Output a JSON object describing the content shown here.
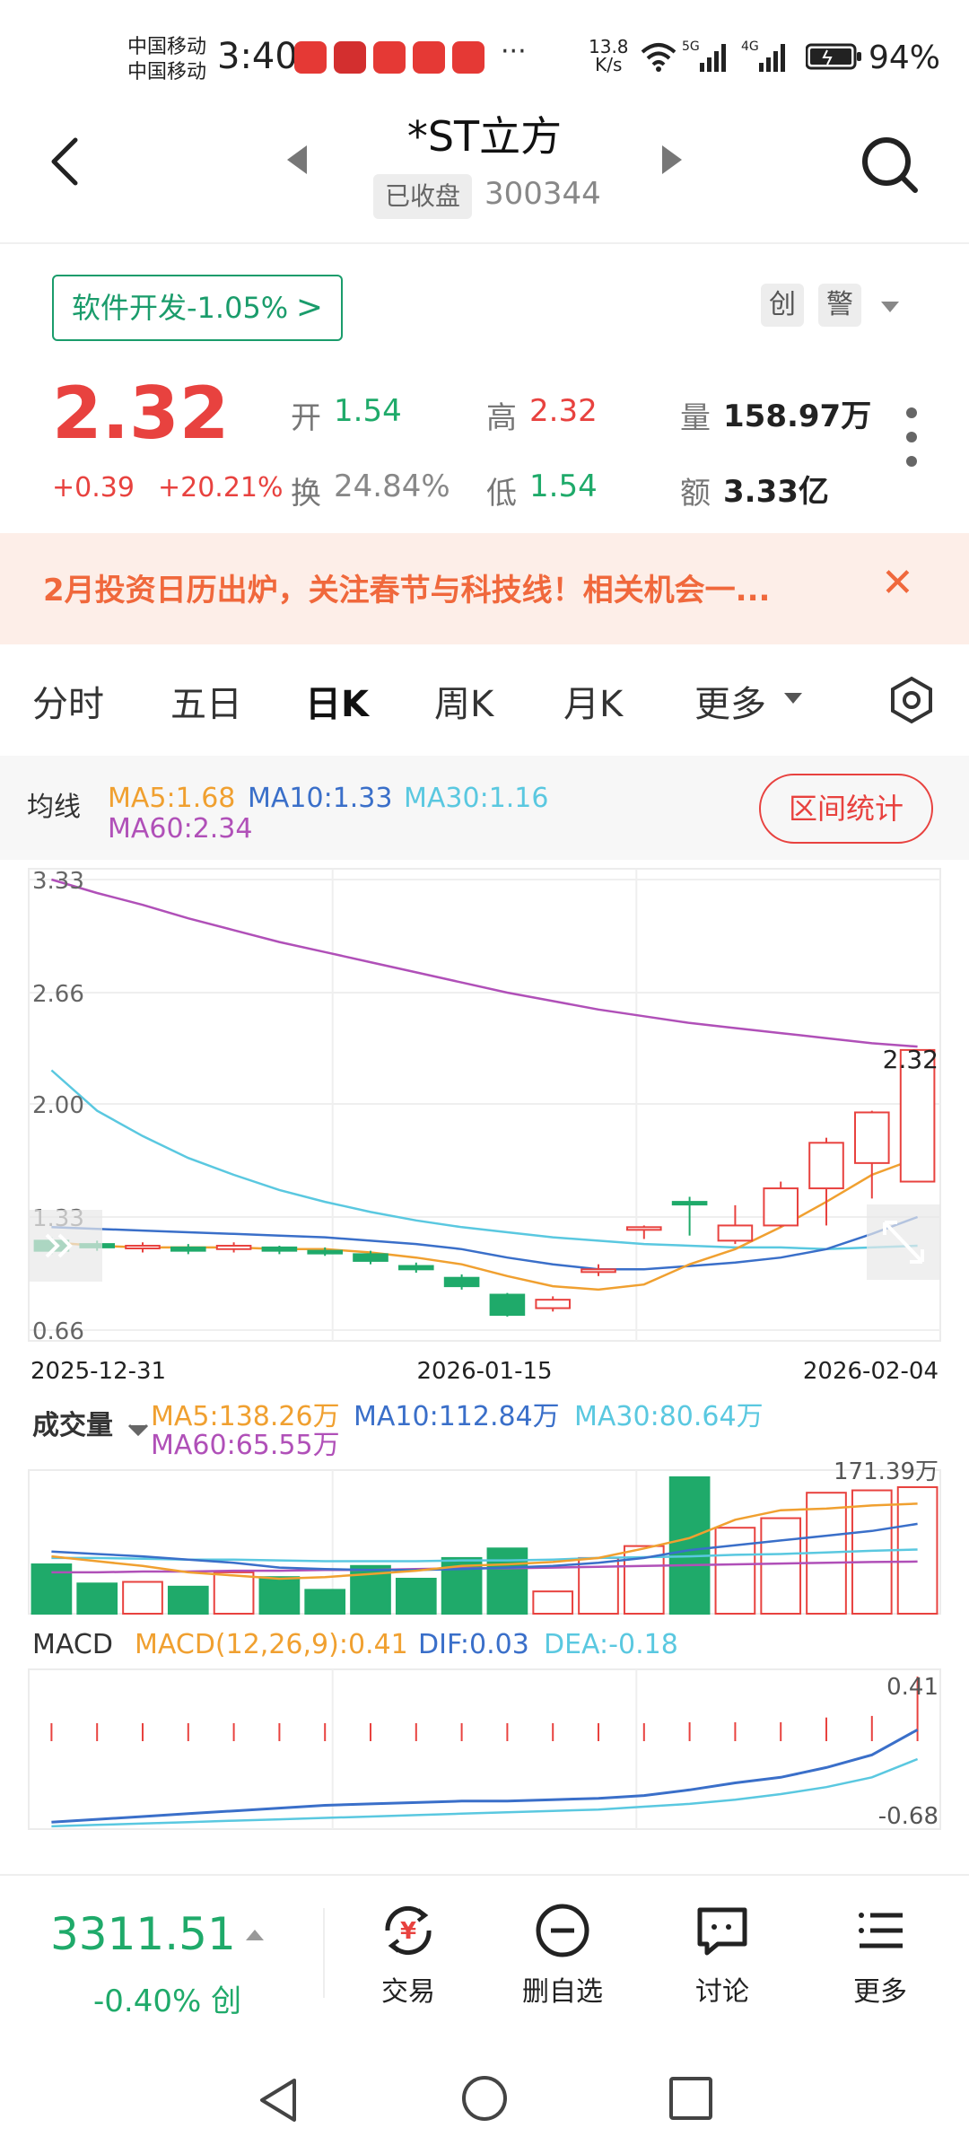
{
  "status_bar": {
    "carrier1": "中国移动",
    "carrier2": "中国移动",
    "time": "3:40",
    "more": "···",
    "net_speed_value": "13.8",
    "net_speed_unit": "K/s",
    "signal1": "5G",
    "signal2": "4G",
    "battery": "94%"
  },
  "header": {
    "title": "*ST立方",
    "status_tag": "已收盘",
    "code": "300344"
  },
  "sector": {
    "label": "软件开发-1.05%",
    "tag1": "创",
    "tag2": "警"
  },
  "quote": {
    "price": "2.32",
    "change": "+0.39",
    "change_pct": "+20.21%",
    "open_label": "开",
    "open": "1.54",
    "high_label": "高",
    "high": "2.32",
    "volume_label": "量",
    "volume": "158.97万",
    "turnover_label": "换",
    "turnover": "24.84%",
    "low_label": "低",
    "low": "1.54",
    "amount_label": "额",
    "amount": "3.33亿"
  },
  "banner": {
    "text": "2月投资日历出炉，关注春节与科技线！相关机会一...",
    "close": "✕"
  },
  "tabs": [
    "分时",
    "五日",
    "日K",
    "周K",
    "月K",
    "更多"
  ],
  "active_tab": "日K",
  "ma_legend": {
    "title": "均线",
    "ma5": "MA5:1.68",
    "ma10": "MA10:1.33",
    "ma30": "MA30:1.16",
    "ma60": "MA60:2.34",
    "range_button": "区间统计"
  },
  "colors": {
    "up": "#e8423f",
    "down": "#1faa6a",
    "ma5": "#f0a030",
    "ma10": "#3a6fc9",
    "ma30": "#5ac8e0",
    "ma60": "#b050b8"
  },
  "chart_data": [
    {
      "type": "candlestick",
      "y_ticks": [
        "3.33",
        "2.66",
        "2.00",
        "1.33",
        "0.66"
      ],
      "ylim": [
        0.66,
        3.33
      ],
      "x_labels": [
        "2025-12-31",
        "2026-01-15",
        "2026-02-04"
      ],
      "last_price_label": "2.32",
      "candles": [
        {
          "o": 1.19,
          "c": 1.13,
          "h": 1.21,
          "l": 1.11
        },
        {
          "o": 1.17,
          "c": 1.15,
          "h": 1.19,
          "l": 1.13
        },
        {
          "o": 1.15,
          "c": 1.16,
          "h": 1.18,
          "l": 1.12
        },
        {
          "o": 1.15,
          "c": 1.13,
          "h": 1.17,
          "l": 1.11
        },
        {
          "o": 1.14,
          "c": 1.16,
          "h": 1.18,
          "l": 1.12
        },
        {
          "o": 1.15,
          "c": 1.13,
          "h": 1.16,
          "l": 1.11
        },
        {
          "o": 1.13,
          "c": 1.12,
          "h": 1.15,
          "l": 1.1
        },
        {
          "o": 1.11,
          "c": 1.07,
          "h": 1.13,
          "l": 1.05
        },
        {
          "o": 1.04,
          "c": 1.02,
          "h": 1.06,
          "l": 1.0
        },
        {
          "o": 0.97,
          "c": 0.92,
          "h": 0.99,
          "l": 0.9
        },
        {
          "o": 0.87,
          "c": 0.75,
          "h": 0.88,
          "l": 0.74
        },
        {
          "o": 0.79,
          "c": 0.84,
          "h": 0.86,
          "l": 0.77
        },
        {
          "o": 1.01,
          "c": 1.02,
          "h": 1.05,
          "l": 0.98
        },
        {
          "o": 1.26,
          "c": 1.27,
          "h": 1.28,
          "l": 1.2
        },
        {
          "o": 1.42,
          "c": 1.41,
          "h": 1.45,
          "l": 1.22
        },
        {
          "o": 1.19,
          "c": 1.28,
          "h": 1.4,
          "l": 1.17
        },
        {
          "o": 1.28,
          "c": 1.5,
          "h": 1.54,
          "l": 1.27
        },
        {
          "o": 1.5,
          "c": 1.77,
          "h": 1.8,
          "l": 1.28
        },
        {
          "o": 1.65,
          "c": 1.95,
          "h": 1.96,
          "l": 1.44
        },
        {
          "o": 1.54,
          "c": 2.32,
          "h": 2.32,
          "l": 1.54
        }
      ],
      "ma5": [
        1.18,
        1.16,
        1.15,
        1.15,
        1.15,
        1.14,
        1.14,
        1.12,
        1.09,
        1.05,
        0.98,
        0.92,
        0.9,
        0.93,
        1.05,
        1.14,
        1.27,
        1.42,
        1.58,
        1.68
      ],
      "ma10": [
        1.27,
        1.26,
        1.25,
        1.24,
        1.23,
        1.22,
        1.21,
        1.19,
        1.17,
        1.14,
        1.09,
        1.05,
        1.02,
        1.02,
        1.04,
        1.06,
        1.09,
        1.14,
        1.23,
        1.33
      ],
      "ma30": [
        2.2,
        1.96,
        1.81,
        1.68,
        1.58,
        1.49,
        1.42,
        1.36,
        1.31,
        1.27,
        1.24,
        1.21,
        1.19,
        1.17,
        1.16,
        1.15,
        1.15,
        1.14,
        1.15,
        1.16
      ],
      "ma60": [
        3.33,
        3.25,
        3.18,
        3.1,
        3.03,
        2.96,
        2.9,
        2.84,
        2.78,
        2.72,
        2.66,
        2.61,
        2.56,
        2.52,
        2.48,
        2.45,
        2.42,
        2.39,
        2.36,
        2.34
      ]
    },
    {
      "type": "bar",
      "title": "成交量",
      "legend": [
        "MA5:138.26万",
        "MA10:112.84万",
        "MA30:80.64万",
        "MA60:65.55万"
      ],
      "max_label": "171.39万",
      "ylim": [
        0,
        171.39
      ],
      "values": [
        62,
        38,
        40,
        34,
        52,
        46,
        30,
        60,
        44,
        70,
        82,
        28,
        70,
        85,
        171.39,
        108,
        120,
        152,
        155,
        158.97
      ],
      "up": [
        false,
        false,
        true,
        false,
        true,
        false,
        false,
        false,
        false,
        false,
        false,
        true,
        true,
        true,
        false,
        true,
        true,
        true,
        true,
        true
      ],
      "ma5": [
        72,
        66,
        60,
        52,
        48,
        44,
        46,
        50,
        54,
        60,
        62,
        65,
        70,
        82,
        95,
        118,
        130,
        132,
        136,
        138.26
      ],
      "ma10": [
        78,
        75,
        72,
        68,
        64,
        58,
        56,
        55,
        55,
        56,
        58,
        60,
        64,
        70,
        80,
        86,
        92,
        98,
        104,
        112.84
      ],
      "ma30": [
        70,
        70,
        69,
        68,
        68,
        67,
        66,
        66,
        66,
        67,
        67,
        68,
        70,
        71,
        72,
        74,
        75,
        77,
        79,
        80.64
      ],
      "ma60": [
        52,
        52,
        53,
        53,
        54,
        54,
        55,
        55,
        56,
        57,
        57,
        58,
        59,
        60,
        61,
        62,
        63,
        64,
        65,
        65.55
      ]
    },
    {
      "type": "line",
      "title": "MACD",
      "legend": [
        "MACD(12,26,9):0.41",
        "DIF:0.03",
        "DEA:-0.18"
      ],
      "top_label": "0.41",
      "bottom_label": "-0.68",
      "ylim": [
        -0.68,
        0.41
      ],
      "hist": [
        0.08,
        0.08,
        0.08,
        0.08,
        0.08,
        0.08,
        0.08,
        0.08,
        0.08,
        0.08,
        0.08,
        0.08,
        0.08,
        0.08,
        0.12,
        0.12,
        0.12,
        0.15,
        0.16,
        0.41
      ],
      "dif": [
        -0.63,
        -0.61,
        -0.59,
        -0.57,
        -0.55,
        -0.53,
        -0.51,
        -0.5,
        -0.49,
        -0.48,
        -0.48,
        -0.47,
        -0.46,
        -0.44,
        -0.4,
        -0.35,
        -0.31,
        -0.24,
        -0.15,
        0.03
      ],
      "dea": [
        -0.66,
        -0.65,
        -0.64,
        -0.63,
        -0.62,
        -0.61,
        -0.6,
        -0.59,
        -0.58,
        -0.57,
        -0.56,
        -0.55,
        -0.54,
        -0.52,
        -0.5,
        -0.47,
        -0.43,
        -0.38,
        -0.31,
        -0.18
      ]
    }
  ],
  "volume_title": "成交量",
  "macd_title": "MACD",
  "bottom_bar": {
    "index_value": "3311.51",
    "index_change": "-0.40%",
    "index_tag": "创",
    "buttons": [
      "交易",
      "删自选",
      "讨论",
      "更多"
    ]
  }
}
